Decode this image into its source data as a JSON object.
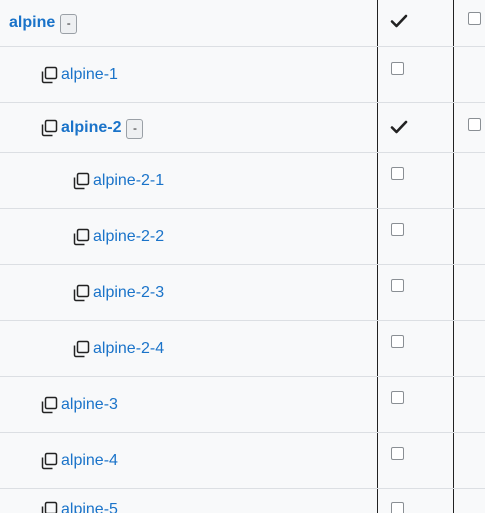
{
  "tree": {
    "toggle_label": "-",
    "rows": [
      {
        "label": "alpine",
        "bold": true,
        "toggle": true,
        "icon": null,
        "checked": true,
        "extra_checkbox": true
      },
      {
        "label": "alpine-1",
        "bold": false,
        "toggle": false,
        "icon": "copy-icon",
        "checked": false,
        "extra_checkbox": false
      },
      {
        "label": "alpine-2",
        "bold": true,
        "toggle": true,
        "icon": "copy-icon",
        "checked": true,
        "extra_checkbox": true
      },
      {
        "label": "alpine-2-1",
        "bold": false,
        "toggle": false,
        "icon": "copy-icon",
        "checked": false,
        "extra_checkbox": false
      },
      {
        "label": "alpine-2-2",
        "bold": false,
        "toggle": false,
        "icon": "copy-icon",
        "checked": false,
        "extra_checkbox": false
      },
      {
        "label": "alpine-2-3",
        "bold": false,
        "toggle": false,
        "icon": "copy-icon",
        "checked": false,
        "extra_checkbox": false
      },
      {
        "label": "alpine-2-4",
        "bold": false,
        "toggle": false,
        "icon": "copy-icon",
        "checked": false,
        "extra_checkbox": false
      },
      {
        "label": "alpine-3",
        "bold": false,
        "toggle": false,
        "icon": "copy-icon",
        "checked": false,
        "extra_checkbox": false
      },
      {
        "label": "alpine-4",
        "bold": false,
        "toggle": false,
        "icon": "copy-icon",
        "checked": false,
        "extra_checkbox": false
      },
      {
        "label": "alpine-5",
        "bold": false,
        "toggle": false,
        "icon": "copy-icon",
        "checked": false,
        "extra_checkbox": false
      }
    ]
  },
  "colors": {
    "link": "#1a73c9",
    "background": "#f8f9fa",
    "row_divider": "#dcdfe3",
    "column_border": "#222222"
  }
}
